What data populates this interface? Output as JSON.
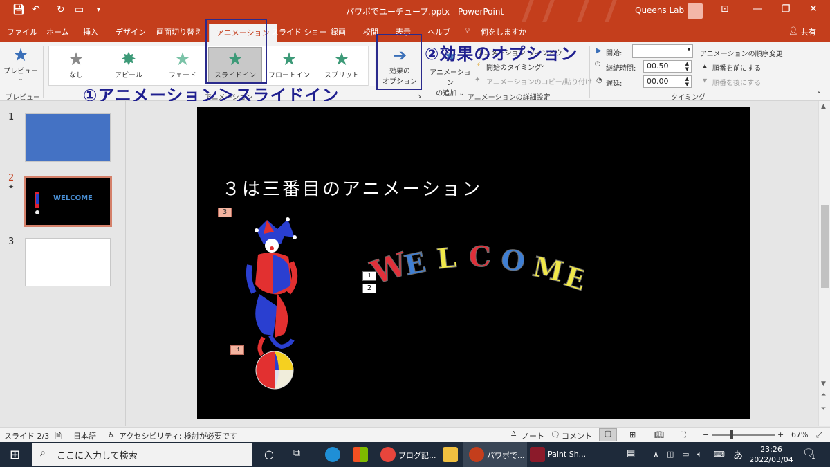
{
  "titlebar": {
    "doc_title": "パワポでユーチューブ.pptx  -  PowerPoint",
    "user_name": "Queens Lab"
  },
  "tabs": [
    "ファイル",
    "ホーム",
    "挿入",
    "デザイン",
    "画面切り替え",
    "アニメーション",
    "スライド ショー",
    "録画",
    "校閲",
    "表示",
    "ヘルプ",
    "何をしますか"
  ],
  "share_label": "共有",
  "ribbon": {
    "preview": "プレビュー",
    "preview_group": "プレビュー",
    "gallery": [
      "なし",
      "アピール",
      "フェード",
      "スライドイン",
      "フロートイン",
      "スプリット"
    ],
    "effect_options": [
      "効果の",
      "オプション"
    ],
    "add_animation": [
      "アニメーション",
      "の追加"
    ],
    "animation_pane": "アニメーション ウィンドウ",
    "start_trigger": "開始のタイミング",
    "anim_painter": "アニメーションのコピー/貼り付け",
    "advanced_group": "アニメーションの詳細設定",
    "start_label": "開始:",
    "duration_label": "継続時間:",
    "duration_value": "00.50",
    "delay_label": "遅延:",
    "delay_value": "00.00",
    "reorder_title": "アニメーションの順序変更",
    "move_earlier": "順番を前にする",
    "move_later": "順番を後にする",
    "timing_group": "タイミング",
    "anim_group_partial": "アニメーション"
  },
  "annotations": {
    "step1": "①アニメーション＞スライドイン",
    "step2": "②効果のオプション"
  },
  "thumbnails": [
    {
      "num": "1",
      "color": "#4472c4"
    },
    {
      "num": "2",
      "color": "#000000"
    },
    {
      "num": "3",
      "color": "#ffffff"
    }
  ],
  "slide": {
    "title": "３は三番目のアニメーション",
    "welcome_letters": [
      "W",
      "E",
      "L",
      "C",
      "O",
      "M",
      "E"
    ],
    "welcome_colors": [
      "#e0303a",
      "#3f7fd4",
      "#f0e84a",
      "#e0303a",
      "#3f7fd4",
      "#f0e84a",
      "#f0e84a"
    ],
    "tag_jester": "3",
    "tag_ball": "3",
    "tag_1": "1",
    "tag_2": "2"
  },
  "status": {
    "slide_pos": "スライド 2/3",
    "language": "日本語",
    "accessibility": "アクセシビリティ: 検討が必要です",
    "notes": "ノート",
    "comments": "コメント",
    "zoom": "67%"
  },
  "taskbar": {
    "search_placeholder": "ここに入力して検索",
    "chrome_label": "ブログ記...",
    "ppt_label": "パワポで...",
    "psp_label": "Paint Sh...",
    "time": "23:26",
    "date": "2022/03/04",
    "notif_count": "1",
    "ime": "あ"
  }
}
